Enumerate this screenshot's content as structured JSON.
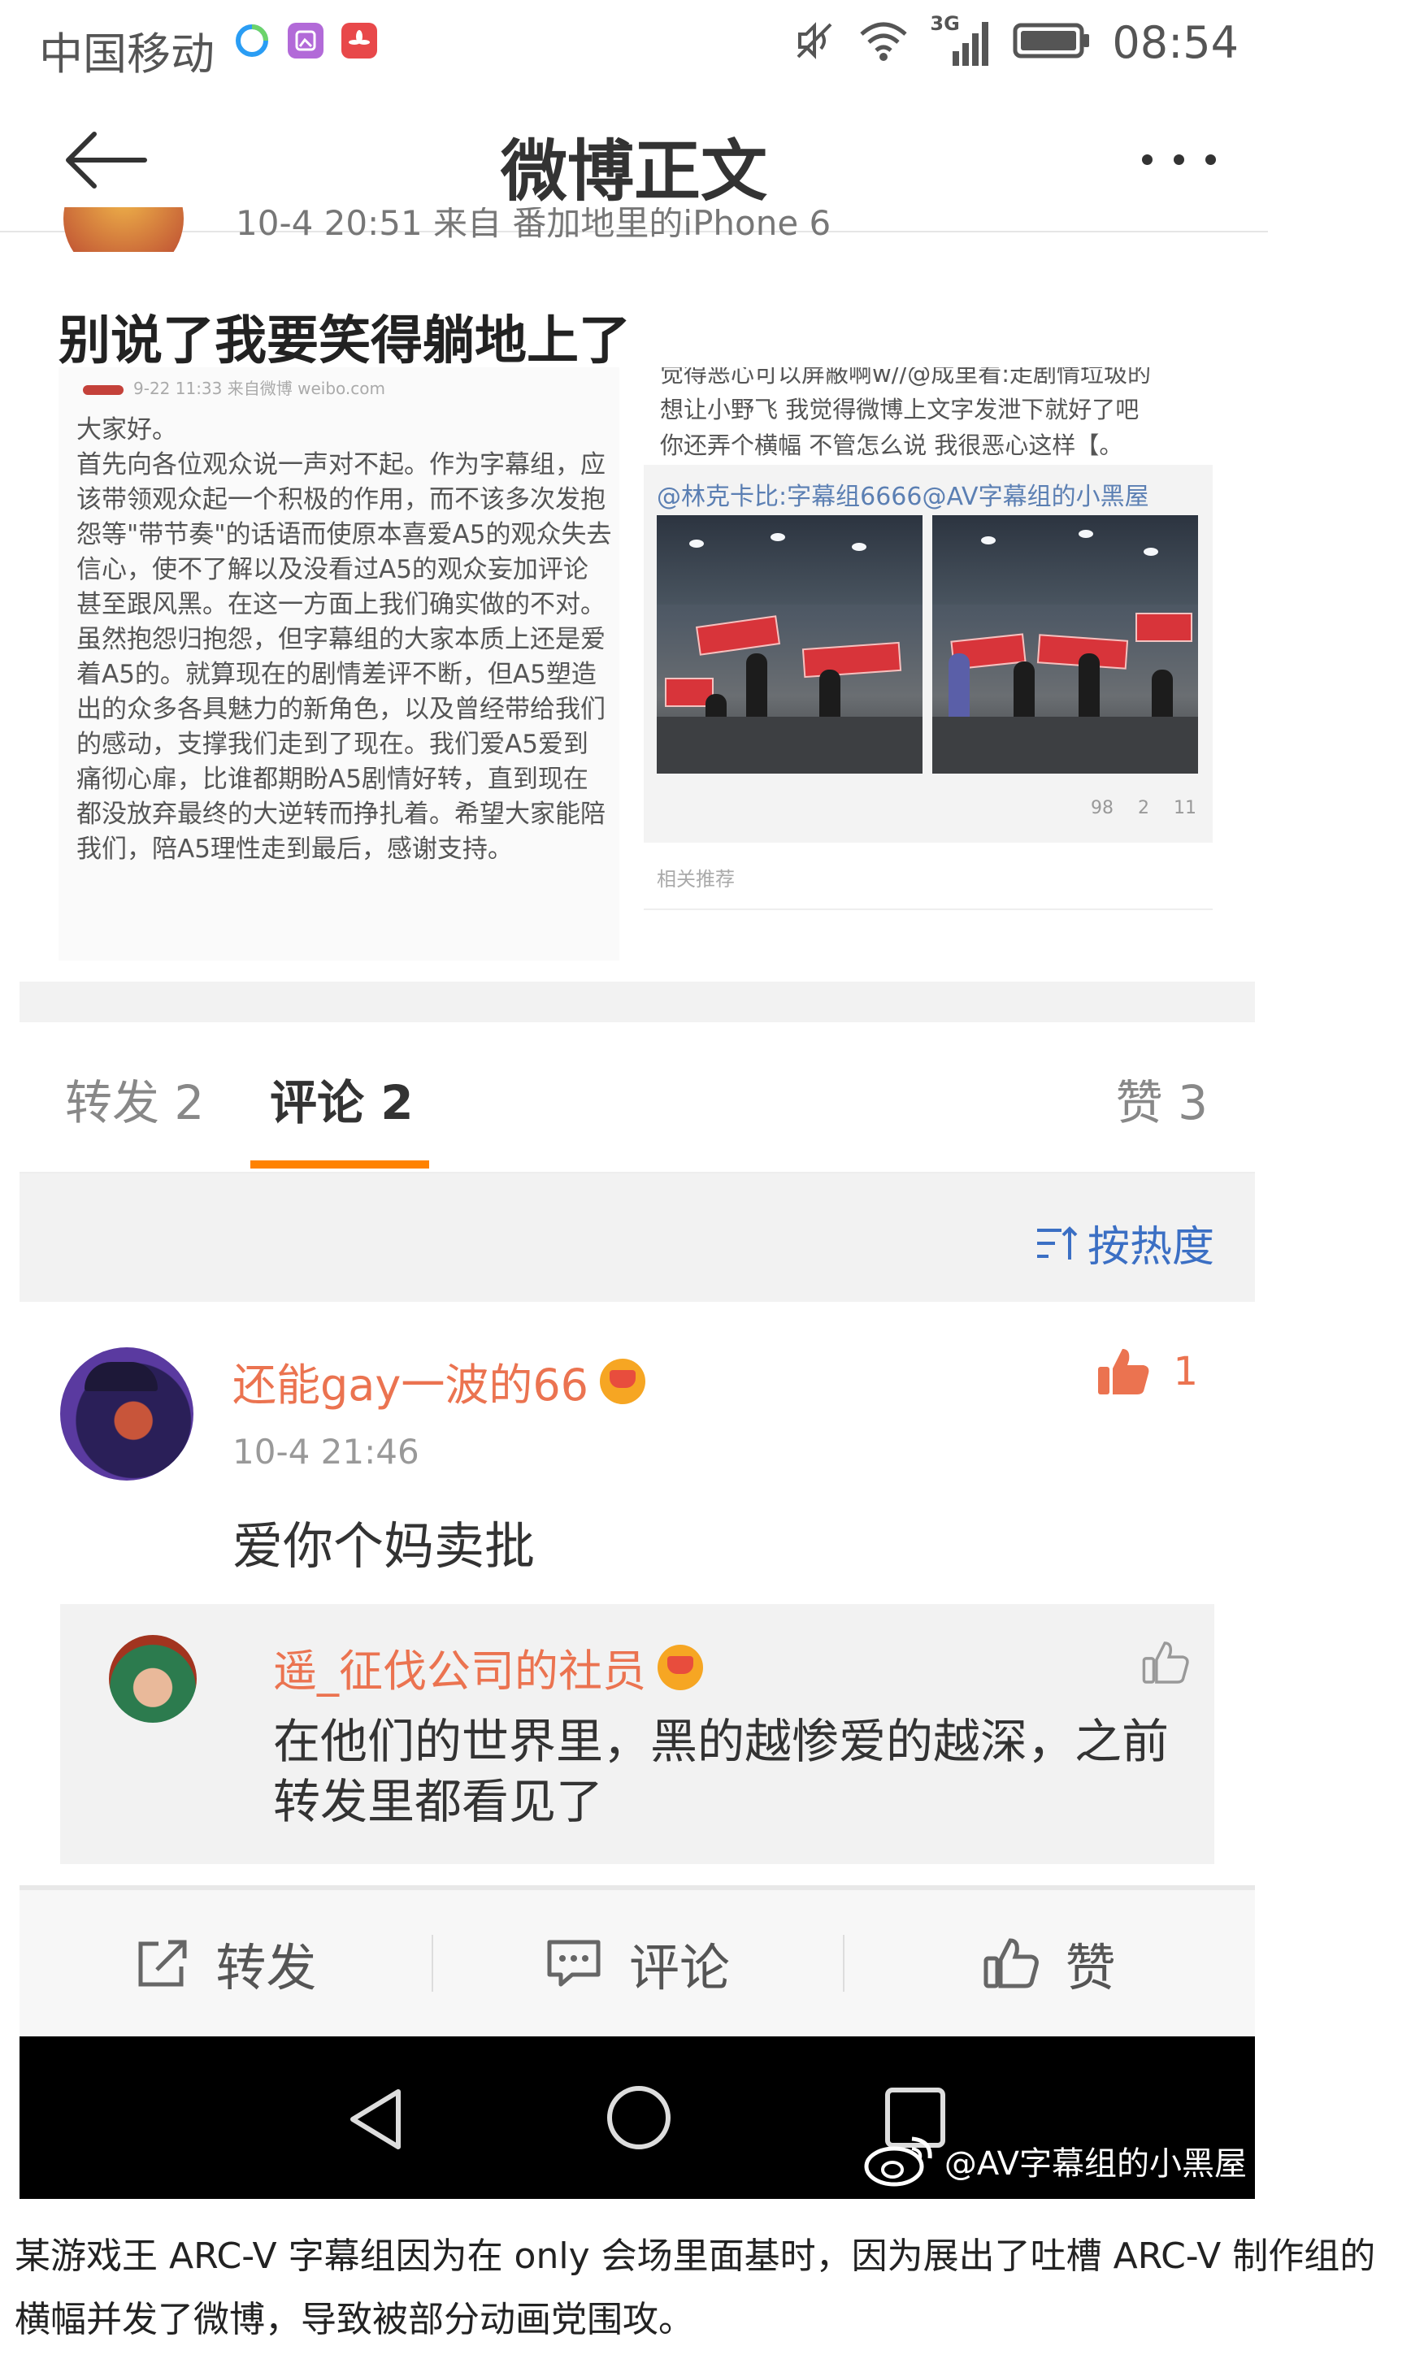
{
  "status_bar": {
    "carrier": "中国移动",
    "network": "3G",
    "time": "08:54"
  },
  "header": {
    "title": "微博正文"
  },
  "post": {
    "meta_partial": "10-4 20:51  来自 番加地里的iPhone 6",
    "text": "别说了我要笑得躺地上了"
  },
  "embedded_image": {
    "left_meta": "9-22 11:33  来自微博 weibo.com",
    "left_body": "大家好。\n首先向各位观众说一声对不起。作为字幕组，应该带领观众起一个积极的作用，而不该多次发抱怨等\"带节奏\"的话语而使原本喜爱A5的观众失去信心，使不了解以及没看过A5的观众妄加评论甚至跟风黑。在这一方面上我们确实做的不对。虽然抱怨归抱怨，但字幕组的大家本质上还是爱着A5的。就算现在的剧情差评不断，但A5塑造出的众多各具魅力的新角色，以及曾经带给我们的感动，支撑我们走到了现在。我们爱A5爱到痛彻心扉，比谁都期盼A5剧情好转，直到现在都没放弃最终的大逆转而挣扎着。希望大家能陪我们，陪A5理性走到最后，感谢支持。",
    "right_top": "觉得恶心可以屏蔽啊w//@成里看:走剧情垃圾的\n想让小野飞 我觉得微博上文字发泄下就好了吧\n你还弄个横幅 不管怎么说 我很恶心这样【。",
    "repost_title": "@林克卡比:字幕组6666@AV字幕组的小黑屋",
    "stats": [
      "98",
      "2",
      "11"
    ],
    "related_label": "相关推荐"
  },
  "tabs": {
    "repost": "转发 2",
    "comment": "评论 2",
    "like": "赞 3"
  },
  "sort": {
    "label": "按热度"
  },
  "comment": {
    "username": "还能gay一波的66",
    "time": "10-4 21:46",
    "text": "爱你个妈卖批",
    "likes": "1",
    "reply": {
      "username": "遥_征伐公司的社员",
      "text": "在他们的世界里，黑的越惨爱的越深，之前转发里都看见了"
    }
  },
  "actions": {
    "repost": "转发",
    "comment": "评论",
    "like": "赞"
  },
  "watermark": "@AV字幕组的小黑屋",
  "caption": "某游戏王 ARC-V 字幕组因为在 only 会场里面基时，因为展出了吐槽 ARC-V 制作组的横幅并发了微博，导致被部分动画党围攻。",
  "colors": {
    "accent_orange": "#ff8200",
    "username_orange": "#eb7350",
    "link_blue": "#3b6fc4"
  }
}
